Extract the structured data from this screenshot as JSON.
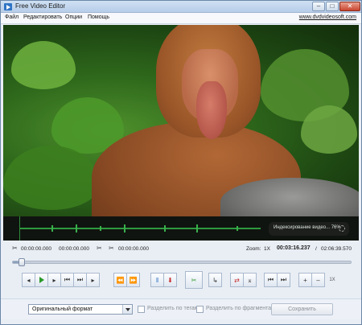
{
  "window": {
    "title": "Free Video Editor"
  },
  "menu": {
    "items": [
      "Файл",
      "Редактировать",
      "Опции",
      "Помощь"
    ],
    "site_link": "www.dvdvideosoft.com"
  },
  "waveform": {
    "indexing_text": "Индексирование видео...  76%"
  },
  "timeline": {
    "sel1_start": "00:00:00.000",
    "sel1_end": "00:00:00.000",
    "sel2_start": "00:00:00.000",
    "zoom_label": "Zoom:",
    "zoom_value": "1X",
    "current_time": "00:03:16.237",
    "separator": "/",
    "total_time": "02:06:39.570",
    "position_fraction": 0.025
  },
  "toolbar": {
    "speed_label": "1X"
  },
  "bottom": {
    "format_value": "Оригинальный формат",
    "split_tags_label": "Разделить по тегам",
    "split_fragments_label": "Разделить по фрагментам",
    "save_label": "Сохранить"
  }
}
